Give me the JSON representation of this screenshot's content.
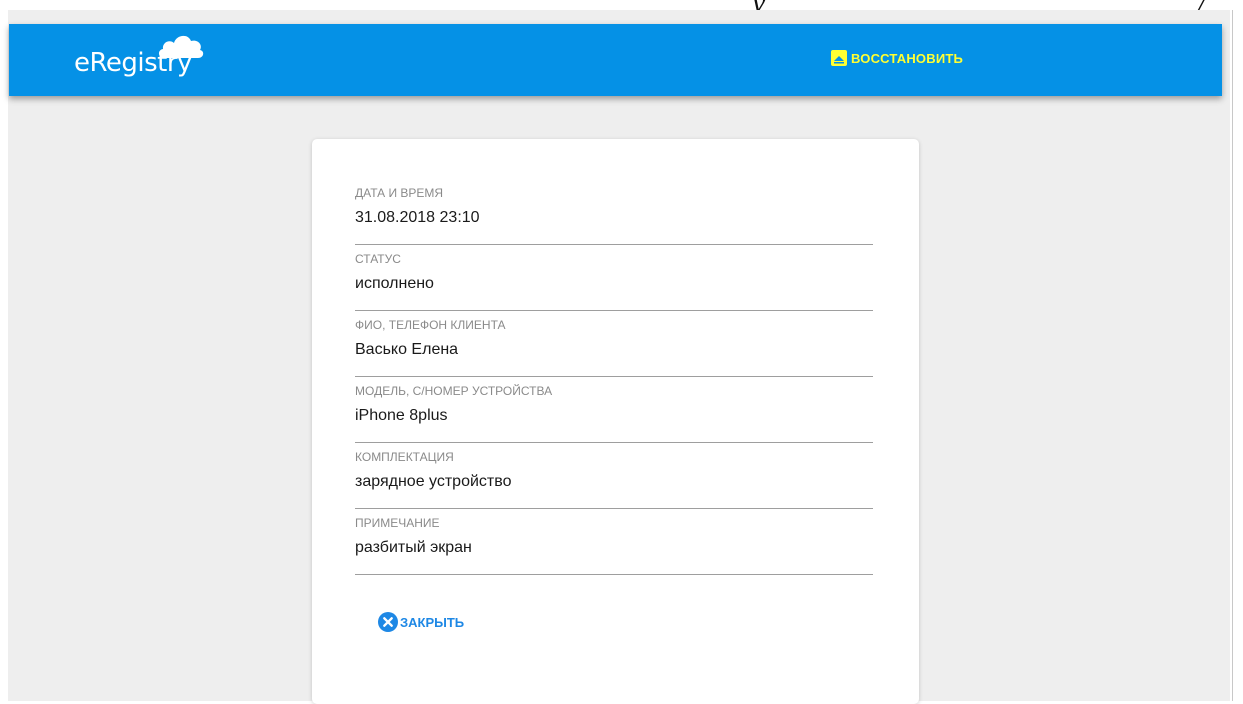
{
  "header": {
    "logo_text": "eRegistry",
    "restore_label": "ВОССТАНОВИТЬ",
    "background_color": "#0591e6",
    "accent_color": "#ffff33",
    "restore_icon": "upload-box-icon",
    "logo_icon": "cloud-icon"
  },
  "record": {
    "fields": [
      {
        "label": "ДАТА И ВРЕМЯ",
        "value": "31.08.2018 23:10"
      },
      {
        "label": "СТАТУС",
        "value": "исполнено"
      },
      {
        "label": "ФИО, ТЕЛЕФОН КЛИЕНТА",
        "value": "Васько Елена"
      },
      {
        "label": "МОДЕЛЬ, С/НОМЕР УСТРОЙСТВА",
        "value": "iPhone 8plus"
      },
      {
        "label": "КОМПЛЕКТАЦИЯ",
        "value": "зарядное устройство"
      },
      {
        "label": "ПРИМЕЧАНИЕ",
        "value": "разбитый экран"
      }
    ],
    "close_label": "ЗАКРЫТЬ",
    "close_icon": "close-circle-icon",
    "close_color": "#1e88e5"
  }
}
